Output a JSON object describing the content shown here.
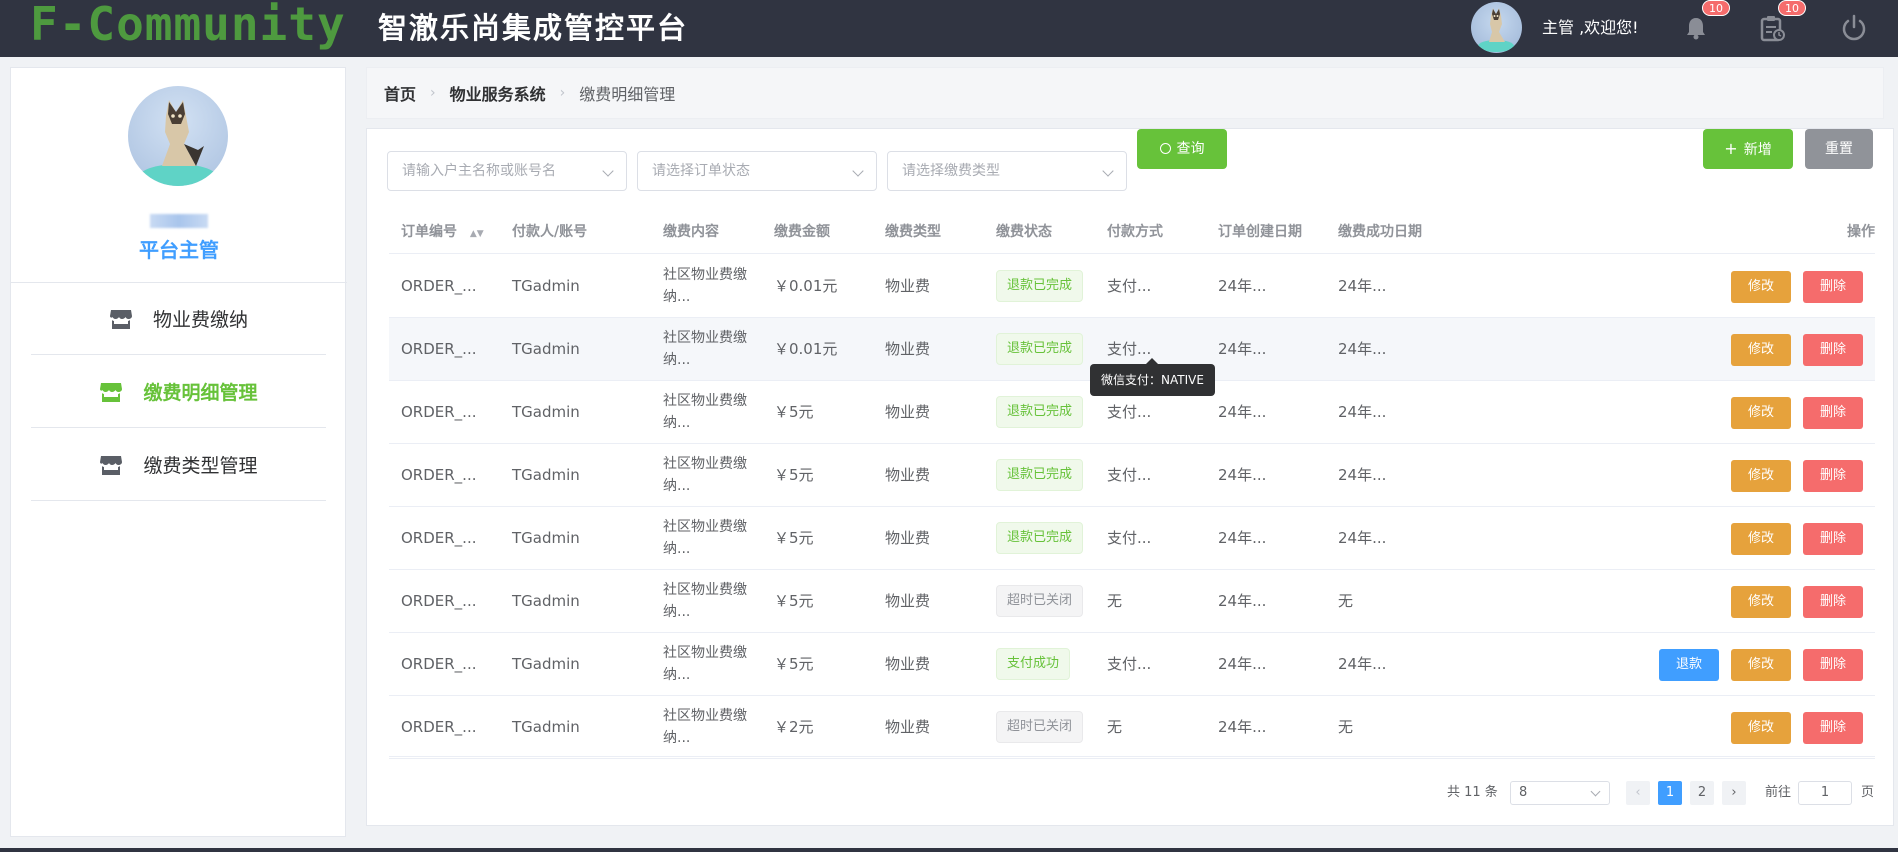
{
  "header": {
    "logo": "F-Community",
    "title": "智澈乐尚集成管控平台",
    "greeting": "主管 ,欢迎您!",
    "bell_badge": "10",
    "todo_badge": "10"
  },
  "sidebar": {
    "role": "平台主管",
    "items": [
      {
        "label": "物业费缴纳",
        "active": false
      },
      {
        "label": "缴费明细管理",
        "active": true
      },
      {
        "label": "缴费类型管理",
        "active": false
      }
    ]
  },
  "breadcrumb": [
    "首页",
    "物业服务系统",
    "缴费明细管理"
  ],
  "filters": {
    "owner_placeholder": "请输入户主名称或账号名",
    "status_placeholder": "请选择订单状态",
    "type_placeholder": "请选择缴费类型",
    "query_label": "查询",
    "add_label": "新增",
    "reset_label": "重置"
  },
  "table": {
    "columns": [
      "订单编号",
      "付款人/账号",
      "缴费内容",
      "缴费金额",
      "缴费类型",
      "缴费状态",
      "付款方式",
      "订单创建日期",
      "缴费成功日期",
      "操作"
    ],
    "rows": [
      {
        "order": "ORDER_...",
        "payer": "TGadmin",
        "content1": "社区物业费缴",
        "content2": "纳...",
        "amount": "￥0.01元",
        "type": "物业费",
        "status": "退款已完成",
        "status_kind": "success",
        "method": "支付...",
        "created": "24年...",
        "paid": "24年...",
        "refund": false
      },
      {
        "order": "ORDER_...",
        "payer": "TGadmin",
        "content1": "社区物业费缴",
        "content2": "纳...",
        "amount": "￥0.01元",
        "type": "物业费",
        "status": "退款已完成",
        "status_kind": "success",
        "method": "支付...",
        "created": "24年...",
        "paid": "24年...",
        "refund": false
      },
      {
        "order": "ORDER_...",
        "payer": "TGadmin",
        "content1": "社区物业费缴",
        "content2": "纳...",
        "amount": "￥5元",
        "type": "物业费",
        "status": "退款已完成",
        "status_kind": "success",
        "method": "支付...",
        "created": "24年...",
        "paid": "24年...",
        "refund": false
      },
      {
        "order": "ORDER_...",
        "payer": "TGadmin",
        "content1": "社区物业费缴",
        "content2": "纳...",
        "amount": "￥5元",
        "type": "物业费",
        "status": "退款已完成",
        "status_kind": "success",
        "method": "支付...",
        "created": "24年...",
        "paid": "24年...",
        "refund": false
      },
      {
        "order": "ORDER_...",
        "payer": "TGadmin",
        "content1": "社区物业费缴",
        "content2": "纳...",
        "amount": "￥5元",
        "type": "物业费",
        "status": "退款已完成",
        "status_kind": "success",
        "method": "支付...",
        "created": "24年...",
        "paid": "24年...",
        "refund": false
      },
      {
        "order": "ORDER_...",
        "payer": "TGadmin",
        "content1": "社区物业费缴",
        "content2": "纳...",
        "amount": "￥5元",
        "type": "物业费",
        "status": "超时已关闭",
        "status_kind": "info",
        "method": "无",
        "created": "24年...",
        "paid": "无",
        "refund": false
      },
      {
        "order": "ORDER_...",
        "payer": "TGadmin",
        "content1": "社区物业费缴",
        "content2": "纳...",
        "amount": "￥5元",
        "type": "物业费",
        "status": "支付成功",
        "status_kind": "success",
        "method": "支付...",
        "created": "24年...",
        "paid": "24年...",
        "refund": true
      },
      {
        "order": "ORDER_...",
        "payer": "TGadmin",
        "content1": "社区物业费缴",
        "content2": "纳...",
        "amount": "￥2元",
        "type": "物业费",
        "status": "超时已关闭",
        "status_kind": "info",
        "method": "无",
        "created": "24年...",
        "paid": "无",
        "refund": false
      }
    ],
    "action_labels": {
      "refund": "退款",
      "edit": "修改",
      "delete": "删除"
    }
  },
  "tooltip": "微信支付：NATIVE",
  "pagination": {
    "total": "共 11 条",
    "page_size": "8",
    "pages": [
      "1",
      "2"
    ],
    "current": "1",
    "goto_prefix": "前往",
    "goto_value": "1",
    "goto_suffix": "页"
  },
  "colors": {
    "header_bg": "#303441",
    "logo_green": "#4e9a3f",
    "success": "#67c23a",
    "warning": "#e6a23c",
    "danger": "#f56c6c",
    "primary": "#409eff"
  }
}
